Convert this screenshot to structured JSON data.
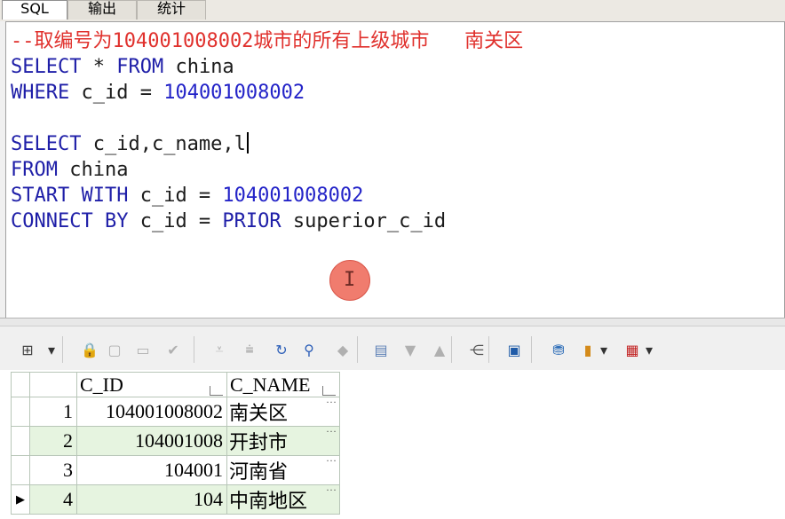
{
  "tabs": [
    {
      "label": "SQL",
      "active": true
    },
    {
      "label": "输出",
      "active": false
    },
    {
      "label": "统计",
      "active": false
    }
  ],
  "editor": {
    "lines": [
      [
        {
          "t": "--取编号为104001008002城市的所有上级城市   南关区",
          "c": "cmt"
        }
      ],
      [
        {
          "t": "SELECT ",
          "c": "kw"
        },
        {
          "t": "* ",
          "c": "plain"
        },
        {
          "t": "FROM ",
          "c": "kw"
        },
        {
          "t": "china",
          "c": "plain"
        }
      ],
      [
        {
          "t": "WHERE ",
          "c": "kw"
        },
        {
          "t": "c_id = ",
          "c": "plain"
        },
        {
          "t": "104001008002",
          "c": "num"
        }
      ],
      [],
      [
        {
          "t": "SELECT ",
          "c": "kw"
        },
        {
          "t": "c_id,c_name,l",
          "c": "plain"
        }
      ],
      [
        {
          "t": "FROM ",
          "c": "kw"
        },
        {
          "t": "china",
          "c": "plain"
        }
      ],
      [
        {
          "t": "START WITH ",
          "c": "kw"
        },
        {
          "t": "c_id = ",
          "c": "plain"
        },
        {
          "t": "104001008002",
          "c": "num"
        }
      ],
      [
        {
          "t": "CONNECT BY ",
          "c": "kw"
        },
        {
          "t": "c_id = ",
          "c": "plain"
        },
        {
          "t": "PRIOR ",
          "c": "kw"
        },
        {
          "t": "superior_c_id",
          "c": "plain"
        }
      ]
    ],
    "caret_line": 4,
    "cursor_glyph": "I"
  },
  "toolbar": {
    "icons": [
      {
        "name": "grid-options-icon",
        "glyph": "⊞",
        "color": "#444444"
      },
      {
        "name": "dropdown-arrow-icon",
        "glyph": "▾",
        "color": "#333333"
      },
      {
        "name": "lock-icon",
        "glyph": "🔒",
        "color": "#b01818"
      },
      {
        "name": "insert-record-icon",
        "glyph": "▢",
        "color": "#b0b0b0"
      },
      {
        "name": "delete-record-icon",
        "glyph": "▭",
        "color": "#b0b0b0"
      },
      {
        "name": "post-changes-icon",
        "glyph": "✔",
        "color": "#b0b0b0"
      },
      {
        "name": "filter-down-icon",
        "glyph": "⩡",
        "color": "#b0b0b0"
      },
      {
        "name": "filter-all-icon",
        "glyph": "⩧",
        "color": "#b0b0b0"
      },
      {
        "name": "refresh-icon",
        "glyph": "↻",
        "color": "#2d5fb8"
      },
      {
        "name": "find-icon",
        "glyph": "⚲",
        "color": "#2d5fb8"
      },
      {
        "name": "clear-icon",
        "glyph": "◆",
        "color": "#b0b0b0"
      },
      {
        "name": "single-record-view-icon",
        "glyph": "▤",
        "color": "#5b7fb5"
      },
      {
        "name": "move-down-icon",
        "glyph": "▼",
        "color": "#b0b0b0"
      },
      {
        "name": "move-up-icon",
        "glyph": "▲",
        "color": "#b0b0b0"
      },
      {
        "name": "query-by-example-icon",
        "glyph": "⋲",
        "color": "#555555"
      },
      {
        "name": "save-icon",
        "glyph": "▣",
        "color": "#1f5ba8"
      },
      {
        "name": "export-data-icon",
        "glyph": "⛃",
        "color": "#2d6db8"
      },
      {
        "name": "chart-icon",
        "glyph": "▮",
        "color": "#d48a1a"
      },
      {
        "name": "dropdown-arrow-icon",
        "glyph": "▾",
        "color": "#333333"
      },
      {
        "name": "table-view-icon",
        "glyph": "▦",
        "color": "#c21f1f"
      },
      {
        "name": "dropdown-arrow-icon",
        "glyph": "▾",
        "color": "#333333"
      }
    ]
  },
  "grid": {
    "columns": [
      "C_ID",
      "C_NAME"
    ],
    "rows": [
      {
        "num": "1",
        "c_id": "104001008002",
        "c_name": "南关区",
        "current": false
      },
      {
        "num": "2",
        "c_id": "104001008",
        "c_name": "开封市",
        "current": false
      },
      {
        "num": "3",
        "c_id": "104001",
        "c_name": "河南省",
        "current": false
      },
      {
        "num": "4",
        "c_id": "104",
        "c_name": "中南地区",
        "current": true
      }
    ],
    "ellipsis": "···",
    "current_row_marker": "▶"
  },
  "colors": {
    "keyword": "#1f1fa8",
    "number": "#2323c8",
    "comment": "#e0312d",
    "row_alt": "#e6f4e0"
  }
}
